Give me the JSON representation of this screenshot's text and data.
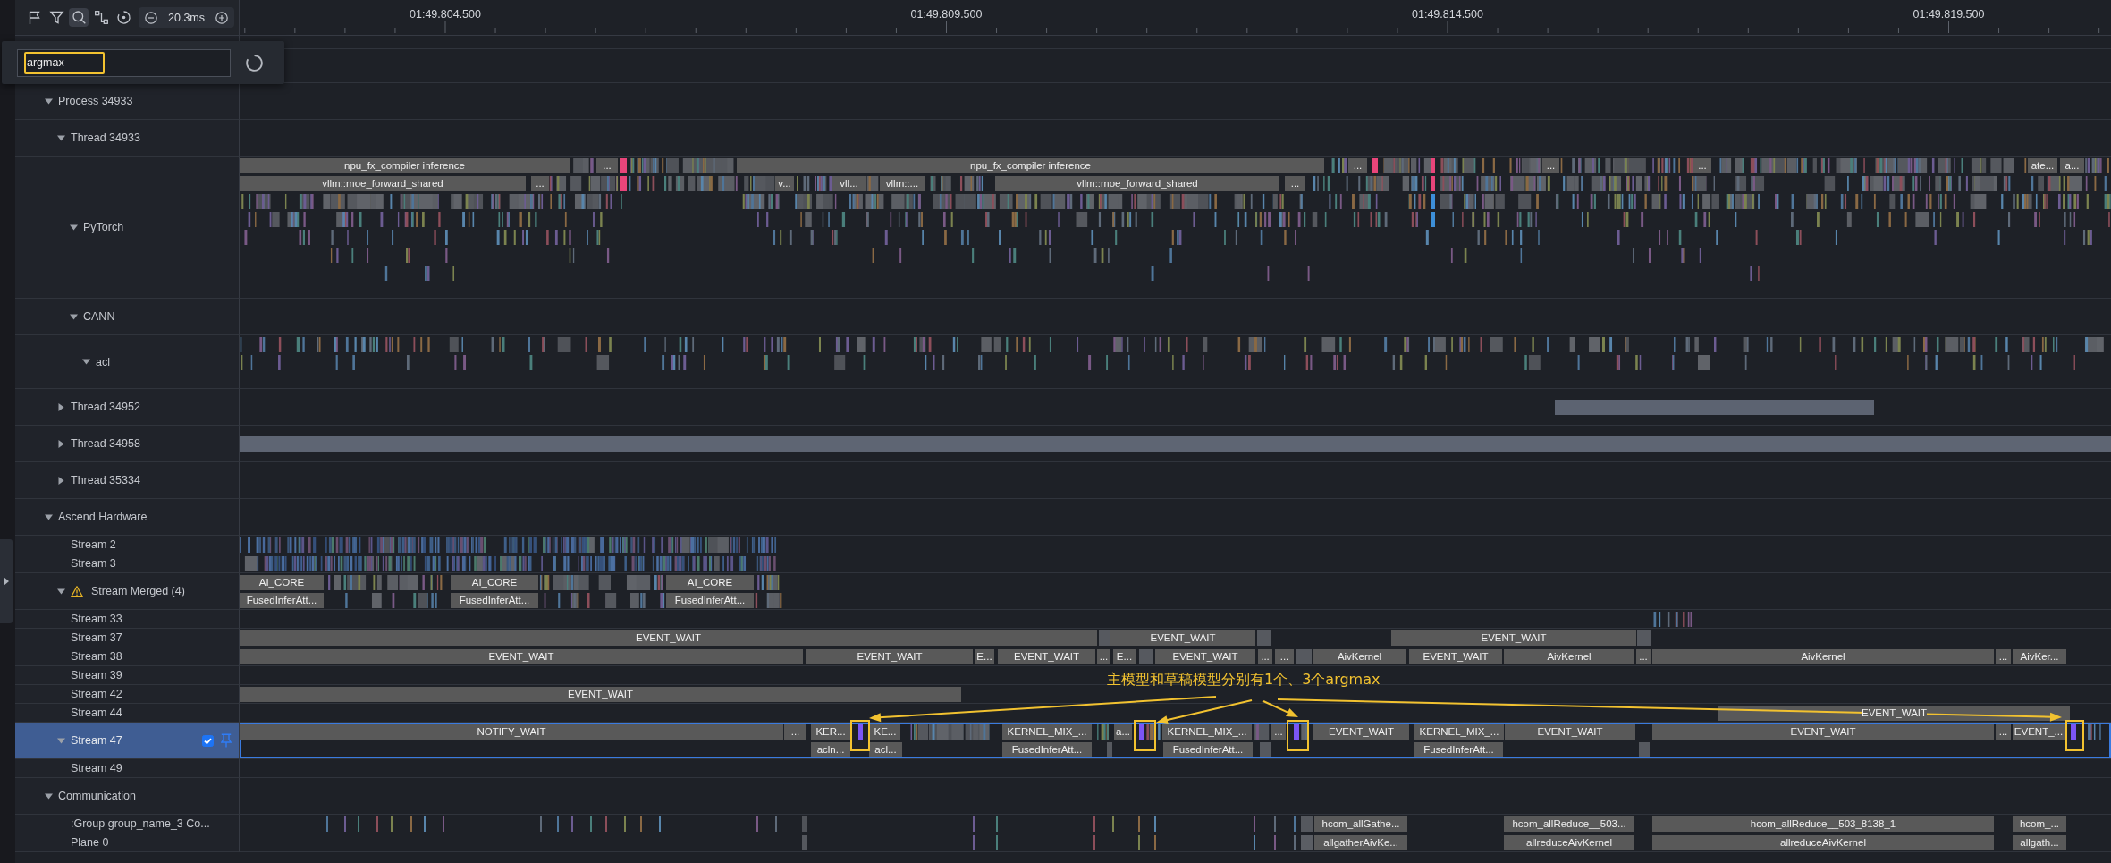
{
  "toolbar": {
    "tools": [
      {
        "selected": false
      },
      {
        "selected": false
      },
      {
        "selected": true
      },
      {
        "selected": false
      },
      {
        "selected": false
      }
    ],
    "zoom": "20.3ms"
  },
  "search": {
    "value": "argmax",
    "highlighted": true,
    "loading": true
  },
  "time_axis": {
    "labels": [
      "01:49.804.500",
      "01:49.809.500",
      "01:49.814.500",
      "01:49.819.500"
    ]
  },
  "tree": [
    {
      "label": "Process 34933",
      "expanded": true,
      "selected": false,
      "children": [
        {
          "label": "Thread 34933",
          "expanded": true,
          "selected": false,
          "children": [
            {
              "label": "PyTorch",
              "expanded": true,
              "selected": false,
              "slices": [
                [
                  "npu_fx_compiler inference",
                  "...",
                  "npu_fx_compiler inference",
                  "...",
                  "...",
                  "...",
                  "ate...",
                  "a..."
                ],
                [
                  "vllm::moe_forward_shared",
                  "...",
                  "v...",
                  "vll...",
                  "vllm::...",
                  "vllm::moe_forward_shared",
                  "..."
                ]
              ]
            },
            {
              "label": "CANN",
              "expanded": true,
              "selected": false,
              "children": [
                {
                  "label": "acl",
                  "expanded": true,
                  "selected": false
                }
              ]
            }
          ]
        },
        {
          "label": "Thread 34952",
          "expanded": false,
          "selected": false
        },
        {
          "label": "Thread 34958",
          "expanded": false,
          "selected": false
        },
        {
          "label": "Thread 35334",
          "expanded": false,
          "selected": false
        }
      ]
    },
    {
      "label": "Ascend Hardware",
      "expanded": true,
      "selected": false,
      "children": [
        {
          "label": "Stream 2",
          "selected": false
        },
        {
          "label": "Stream 3",
          "selected": false
        },
        {
          "label": "Stream Merged (4)",
          "expanded": true,
          "selected": false,
          "warning": true,
          "slices": [
            [
              "AI_CORE",
              "AI_CORE",
              "AI_CORE"
            ],
            [
              "FusedInferAtt...",
              "FusedInferAtt...",
              "FusedInferAtt..."
            ]
          ]
        },
        {
          "label": "Stream 33",
          "selected": false
        },
        {
          "label": "Stream 37",
          "selected": false,
          "slices": [
            [
              "EVENT_WAIT",
              "EVENT_WAIT",
              "EVENT_WAIT"
            ]
          ]
        },
        {
          "label": "Stream 38",
          "selected": false,
          "slices": [
            [
              "EVENT_WAIT",
              "EVENT_WAIT",
              "E...",
              "EVENT_WAIT",
              "...",
              "E...",
              "EVENT_WAIT",
              "...",
              "...",
              "AivKernel",
              "EVENT_WAIT",
              "AivKernel",
              "...",
              "AivKernel",
              "...",
              "AivKer..."
            ]
          ]
        },
        {
          "label": "Stream 39",
          "selected": false
        },
        {
          "label": "Stream 42",
          "selected": false,
          "slices": [
            [
              "EVENT_WAIT"
            ]
          ]
        },
        {
          "label": "Stream 44",
          "selected": false,
          "slices": [
            [
              "EVENT_WAIT"
            ]
          ]
        },
        {
          "label": "Stream 47",
          "expanded": true,
          "selected": true,
          "checked": true,
          "slices": [
            [
              "NOTIFY_WAIT",
              "...",
              "KER...",
              "KE...",
              "KERNEL_MIX_...",
              "a...",
              "KERNEL_MIX_...",
              "...",
              "EVENT_WAIT",
              "KERNEL_MIX_...",
              "EVENT_WAIT",
              "EVENT_WAIT",
              "...",
              "EVENT_..."
            ],
            [
              "acln...",
              "acl...",
              "FusedInferAtt...",
              "FusedInferAtt...",
              "FusedInferAtt..."
            ]
          ]
        },
        {
          "label": "Stream 49",
          "selected": false
        }
      ]
    },
    {
      "label": "Communication",
      "expanded": true,
      "selected": false,
      "children": [
        {
          "label": ":Group group_name_3 Co...",
          "selected": false,
          "slices": [
            [
              "hcom_allGathe...",
              "hcom_allReduce__503...",
              "hcom_allReduce__503_8138_1",
              "hcom_..."
            ]
          ]
        },
        {
          "label": "Plane 0",
          "selected": false,
          "slices": [
            [
              "allgatherAivKe...",
              "allreduceAivKernel",
              "allreduceAivKernel",
              "allgath..."
            ]
          ]
        }
      ]
    }
  ],
  "annotation": {
    "text": "主模型和草稿模型分别有1个、3个argmax"
  }
}
